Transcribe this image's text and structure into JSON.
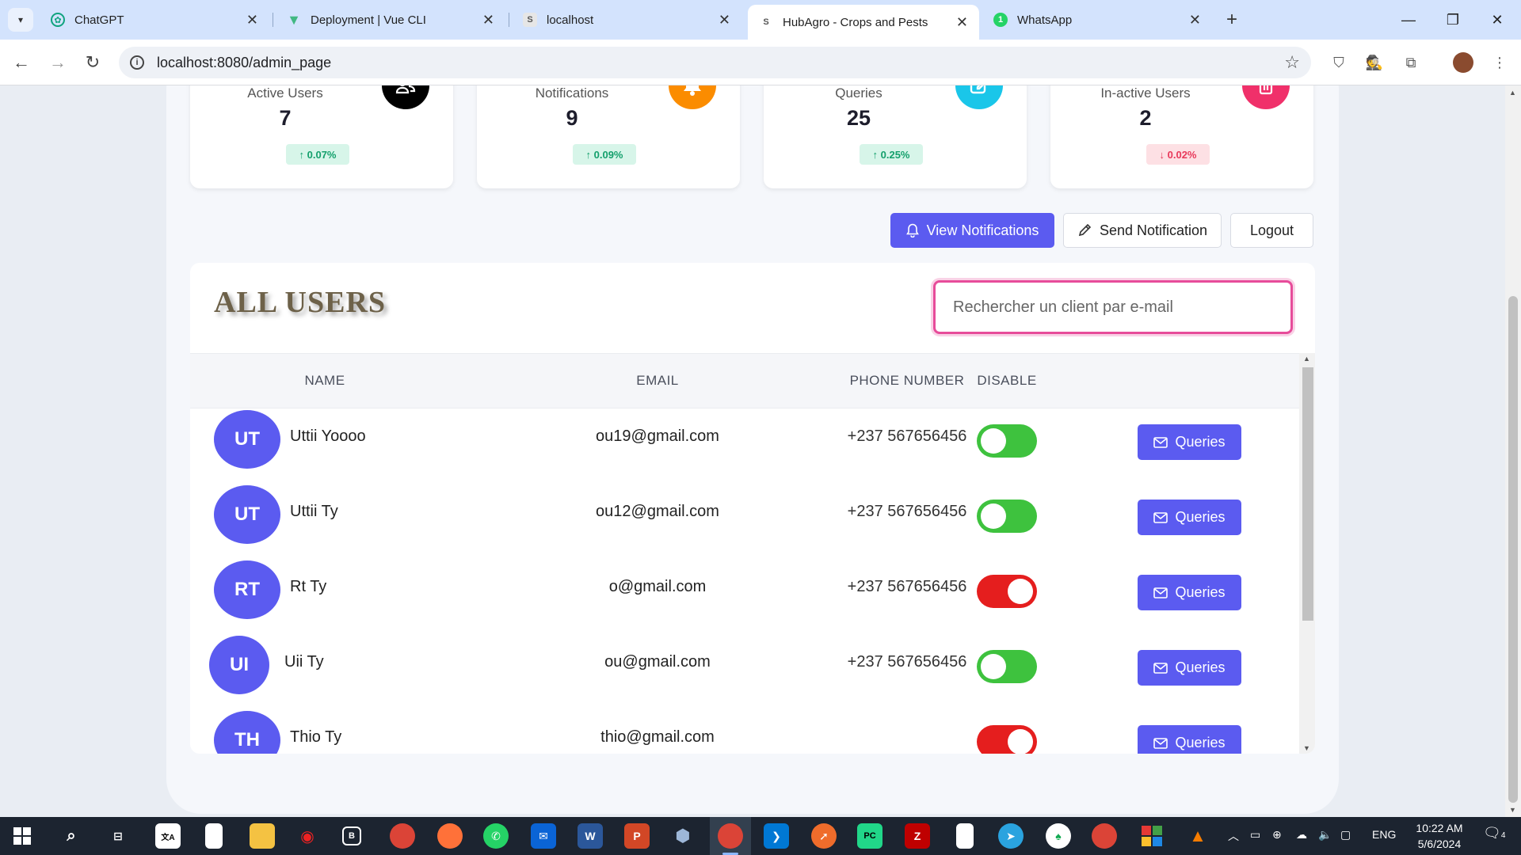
{
  "browser": {
    "tabs": [
      {
        "title": "ChatGPT",
        "favicon": "chatgpt-icon",
        "color": "#10a37f"
      },
      {
        "title": "Deployment | Vue CLI",
        "favicon": "vue-icon",
        "color": "#42b883"
      },
      {
        "title": "localhost",
        "favicon": "s-icon",
        "color": "#555555"
      },
      {
        "title": "HubAgro - Crops and Pests",
        "favicon": "s-icon",
        "color": "#555555",
        "active": true
      },
      {
        "title": "WhatsApp",
        "favicon": "whatsapp-icon",
        "color": "#25d366",
        "badge": "1"
      }
    ],
    "url": "localhost:8080/admin_page"
  },
  "stats": [
    {
      "label": "Active Users",
      "value": "7",
      "change": "0.07%",
      "direction": "up",
      "icon": "users-icon",
      "icon_color": "#000000"
    },
    {
      "label": "Notifications",
      "value": "9",
      "change": "0.09%",
      "direction": "up",
      "icon": "bell-icon",
      "icon_color": "#fb8c00"
    },
    {
      "label": "Queries",
      "value": "25",
      "change": "0.25%",
      "direction": "up",
      "icon": "edit-icon",
      "icon_color": "#1ac6e9"
    },
    {
      "label": "In-active Users",
      "value": "2",
      "change": "0.02%",
      "direction": "down",
      "icon": "trash-icon",
      "icon_color": "#f0306a"
    }
  ],
  "actions": {
    "view_notifications": "View Notifications",
    "send_notification": "Send Notification",
    "logout": "Logout"
  },
  "users_section": {
    "title": "ALL USERS",
    "search_placeholder": "Rechercher un client par e-mail",
    "columns": [
      "NAME",
      "EMAIL",
      "PHONE NUMBER",
      "DISABLE"
    ],
    "rows": [
      {
        "initials": "UT",
        "name": "Uttii Yoooo",
        "email": "ou19@gmail.com",
        "phone": "+237 567656456",
        "disabled": false,
        "action": "Queries"
      },
      {
        "initials": "UT",
        "name": "Uttii Ty",
        "email": "ou12@gmail.com",
        "phone": "+237 567656456",
        "disabled": false,
        "action": "Queries"
      },
      {
        "initials": "RT",
        "name": "Rt Ty",
        "email": "o@gmail.com",
        "phone": "+237 567656456",
        "disabled": true,
        "action": "Queries"
      },
      {
        "initials": "UI",
        "name": "Uii Ty",
        "email": "ou@gmail.com",
        "phone": "+237 567656456",
        "disabled": false,
        "action": "Queries"
      },
      {
        "initials": "TH",
        "name": "Thio Ty",
        "email": "thio@gmail.com",
        "phone": "",
        "disabled": true,
        "action": "Queries"
      }
    ]
  },
  "colors": {
    "accent": "#5b5bf0",
    "toggle_on": "#3ec23e",
    "toggle_off": "#e51e1e",
    "search_border": "#e74c9a"
  },
  "taskbar": {
    "time": "10:22 AM",
    "date": "5/6/2024",
    "language": "ENG",
    "notification_count": "4"
  }
}
